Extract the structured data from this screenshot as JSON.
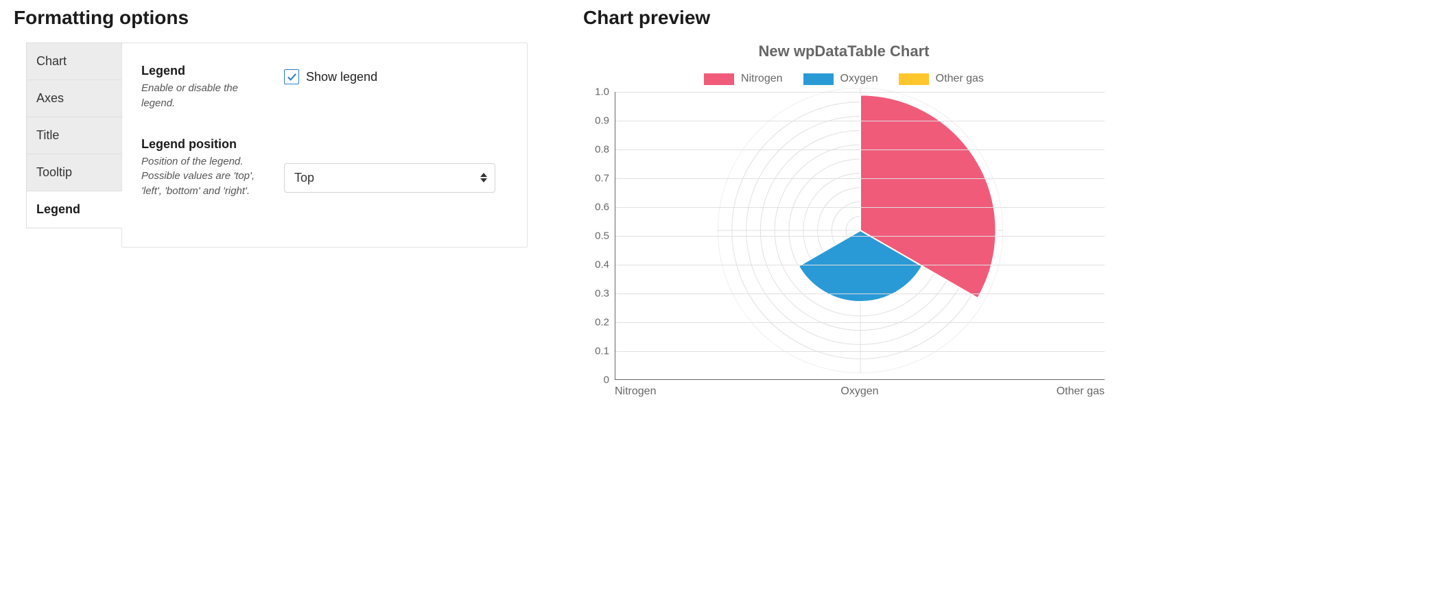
{
  "formatting": {
    "heading": "Formatting options",
    "tabs": [
      {
        "id": "chart",
        "label": "Chart",
        "active": false
      },
      {
        "id": "axes",
        "label": "Axes",
        "active": false
      },
      {
        "id": "title",
        "label": "Title",
        "active": false
      },
      {
        "id": "tooltip",
        "label": "Tooltip",
        "active": false
      },
      {
        "id": "legend",
        "label": "Legend",
        "active": true
      }
    ],
    "legend": {
      "section_label": "Legend",
      "section_help": "Enable or disable the legend.",
      "checkbox_label": "Show legend",
      "checkbox_checked": true,
      "position_label": "Legend position",
      "position_help": "Position of the legend. Possible values are 'top', 'left', 'bottom' and 'right'.",
      "position_value": "Top"
    }
  },
  "preview": {
    "heading": "Chart preview",
    "title": "New wpDataTable Chart",
    "legend_items": [
      {
        "key": "nitrogen",
        "label": "Nitrogen",
        "color": "#f15b7a"
      },
      {
        "key": "oxygen",
        "label": "Oxygen",
        "color": "#2a9ad6"
      },
      {
        "key": "other",
        "label": "Other gas",
        "color": "#ffc62d"
      }
    ],
    "y_ticks": [
      "1.0",
      "0.9",
      "0.8",
      "0.7",
      "0.6",
      "0.5",
      "0.4",
      "0.3",
      "0.2",
      "0.1",
      "0"
    ],
    "x_labels": [
      "Nitrogen",
      "Oxygen",
      "Other gas"
    ]
  },
  "chart_data": {
    "type": "pie",
    "title": "New wpDataTable Chart",
    "categories": [
      "Nitrogen",
      "Oxygen",
      "Other gas"
    ],
    "series": [
      {
        "name": "Nitrogen",
        "value": 0.95,
        "color": "#f15b7a"
      },
      {
        "name": "Oxygen",
        "value": 0.5,
        "color": "#2a9ad6"
      },
      {
        "name": "Other gas",
        "value": 0.0,
        "color": "#ffc62d"
      }
    ],
    "ylabel": "",
    "xlabel": "",
    "ylim": [
      0,
      1.0
    ],
    "legend_position": "top",
    "grid": true
  }
}
